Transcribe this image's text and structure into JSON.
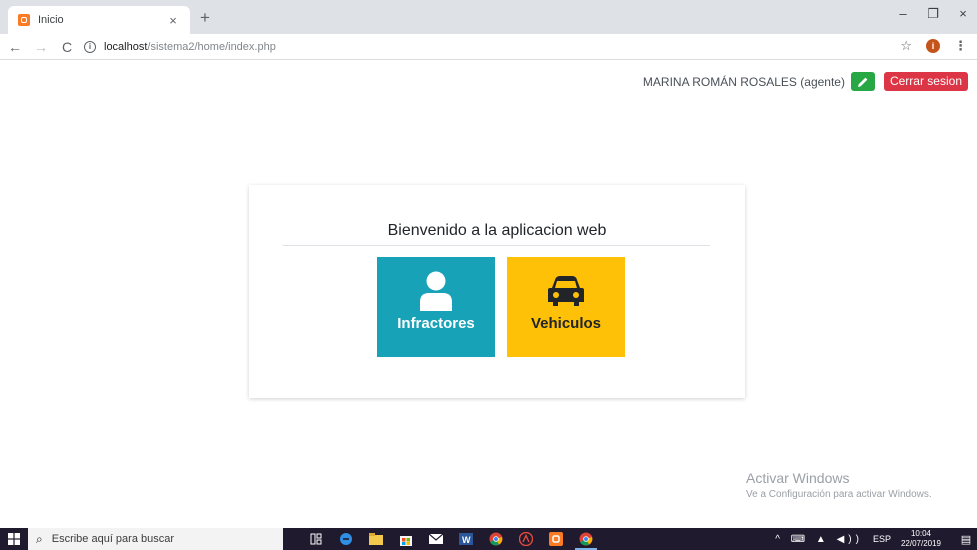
{
  "browser": {
    "tab_title": "Inicio",
    "tab_close": "×",
    "new_tab": "+",
    "window_controls": {
      "minimize": "–",
      "restore": "❐",
      "close": "×"
    },
    "url_host": "localhost",
    "url_path": "/sistema2/home/index.php",
    "nav": {
      "back": "←",
      "forward": "→",
      "reload": "C"
    },
    "info_icon": "i",
    "star_icon": "☆",
    "profile_initial": "i",
    "menu_icon": "⋮"
  },
  "header": {
    "user_name": "MARINA ROMÁN ROSALES (agente)",
    "logout_label": "Cerrar sesion"
  },
  "main": {
    "title": "Bienvenido a la aplicacion web",
    "tiles": [
      {
        "label": "Infractores",
        "icon": "user-icon",
        "color": "#17a2b8"
      },
      {
        "label": "Vehiculos",
        "icon": "car-icon",
        "color": "#ffc107"
      }
    ]
  },
  "watermark": {
    "title": "Activar Windows",
    "subtitle": "Ve a Configuración para activar Windows."
  },
  "taskbar": {
    "search_placeholder": "Escribe aquí para buscar",
    "search_icon": "⌕",
    "language": "ESP",
    "time": "10:04",
    "date": "22/07/2019",
    "tray_icons": "^ ⌨ ▲ ◀))",
    "notification_icon": "▤"
  },
  "colors": {
    "accent_green": "#28a745",
    "accent_red": "#dc3545",
    "info": "#17a2b8",
    "warning": "#ffc107"
  }
}
